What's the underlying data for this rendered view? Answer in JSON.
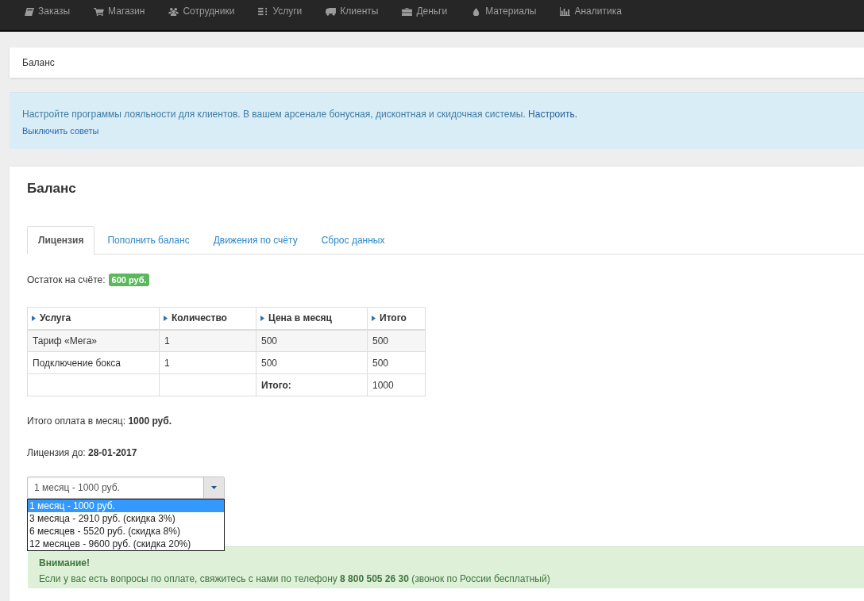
{
  "nav": {
    "items": [
      {
        "label": "Заказы"
      },
      {
        "label": "Магазин"
      },
      {
        "label": "Сотрудники"
      },
      {
        "label": "Услуги"
      },
      {
        "label": "Клиенты"
      },
      {
        "label": "Деньги"
      },
      {
        "label": "Материалы"
      },
      {
        "label": "Аналитика"
      }
    ]
  },
  "breadcrumb": {
    "current": "Баланс"
  },
  "tip": {
    "text": "Настройте программы лояльности для клиентов. В вашем арсенале бонусная, дисконтная и скидочная системы.",
    "link": "Настроить.",
    "dismiss": "Выключить советы"
  },
  "panel": {
    "title": "Баланс",
    "tabs": [
      {
        "label": "Лицензия",
        "selected": true
      },
      {
        "label": "Пополнить баланс",
        "selected": false
      },
      {
        "label": "Движения по счёту",
        "selected": false
      },
      {
        "label": "Сброс данных",
        "selected": false
      }
    ],
    "balance": {
      "label": "Остаток на счёте:",
      "badge": "600 руб."
    },
    "table": {
      "columns": [
        "Услуга",
        "Количество",
        "Цена в месяц",
        "Итого"
      ],
      "rows": [
        [
          "Тариф «Мега»",
          "1",
          "500",
          "500"
        ],
        [
          "Подключение бокса",
          "1",
          "500",
          "500"
        ]
      ],
      "total": {
        "label": "Итого:",
        "value": "1000"
      }
    },
    "monthly_total": "Итого оплата в месяц: **1000 руб.**",
    "license_until": "Лицензия до: **28-01-2017**",
    "period_select": {
      "value": "1 месяц - 1000 руб.",
      "expanded": true,
      "options": [
        {
          "label": "1 месяц - 1000 руб.",
          "selected": true
        },
        {
          "label": "3 месяца - 2910 руб. (скидка 3%)",
          "selected": false
        },
        {
          "label": "6 месяцев - 5520 руб. (скидка 8%)",
          "selected": false
        },
        {
          "label": "12 месяцев - 9600 руб. (скидка 20%)",
          "selected": false
        }
      ]
    },
    "notice": {
      "title": "Внимание!",
      "text": "Если у вас есть вопросы по оплате, свяжитесь с нами по телефону **8 800 505 26 30** (звонок по России бесплатный)"
    }
  }
}
